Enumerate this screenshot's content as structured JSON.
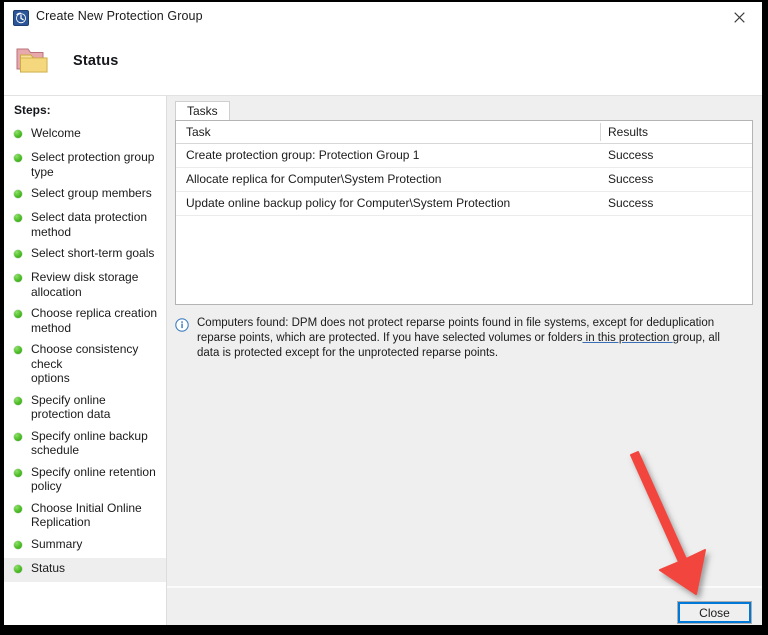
{
  "window": {
    "title": "Create New Protection Group",
    "title_icon": "dpm-recovery-clock-icon",
    "close_icon": "close-icon",
    "close_glyph": "✕"
  },
  "header": {
    "title": "Status",
    "icon": "folder-icon"
  },
  "sidebar": {
    "label": "Steps:",
    "current_step": "Status",
    "items": [
      {
        "label": "Welcome",
        "state": "done"
      },
      {
        "label": "Select protection group type",
        "state": "done"
      },
      {
        "label": "Select group members",
        "state": "done"
      },
      {
        "label": "Select data protection\nmethod",
        "state": "done"
      },
      {
        "label": "Select short-term goals",
        "state": "done"
      },
      {
        "label": "Review disk storage\nallocation",
        "state": "done"
      },
      {
        "label": "Choose replica creation\nmethod",
        "state": "done"
      },
      {
        "label": "Choose consistency check\noptions",
        "state": "done"
      },
      {
        "label": "Specify online protection data",
        "state": "done"
      },
      {
        "label": "Specify online backup\nschedule",
        "state": "done"
      },
      {
        "label": "Specify online retention policy",
        "state": "done"
      },
      {
        "label": "Choose Initial Online\nReplication",
        "state": "done"
      },
      {
        "label": "Summary",
        "state": "done"
      },
      {
        "label": "Status",
        "state": "current"
      }
    ]
  },
  "main": {
    "tabs": [
      {
        "label": "Tasks",
        "active": true
      }
    ],
    "table": {
      "columns": [
        "Task",
        "Results"
      ],
      "rows": [
        {
          "task": "Create protection group: Protection Group 1",
          "result": "Success"
        },
        {
          "task": "Allocate replica for Computer\\System Protection",
          "result": "Success"
        },
        {
          "task": "Update online backup policy for Computer\\System Protection",
          "result": "Success"
        }
      ]
    },
    "info": {
      "icon": "info-icon",
      "text_before": "Computers found: DPM does not protect reparse points found in file systems, except for deduplication reparse points, which are protected. If you have selected volumes or folders",
      "highlight": " in this protection ",
      "text_after": "group, all data is protected except for the unprotected reparse points."
    }
  },
  "footer": {
    "close_label": "Close"
  },
  "annotation": {
    "arrow_color": "#f2453d",
    "arrow_name": "red-pointer-arrow",
    "points_to": "Close"
  }
}
